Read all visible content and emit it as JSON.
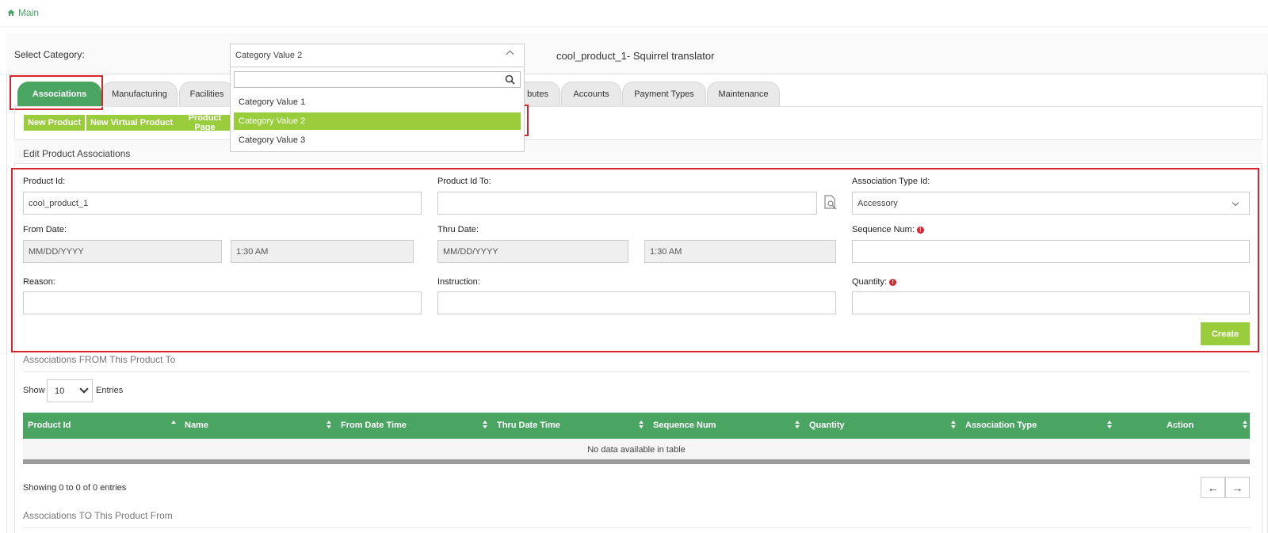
{
  "breadcrumb": {
    "home_label": "Main"
  },
  "header": {
    "select_category_label": "Select Category:",
    "category_value": "Category Value 2",
    "product_title": "cool_product_1- Squirrel translator"
  },
  "category_dropdown": {
    "search_value": "",
    "options": [
      "Category Value 1",
      "Category Value 2",
      "Category Value 3"
    ],
    "selected_index": 1
  },
  "tabs": [
    {
      "label": "Associations",
      "active": true
    },
    {
      "label": "Manufacturing"
    },
    {
      "label": "Facilities"
    },
    {
      "label": "butes"
    },
    {
      "label": "Accounts"
    },
    {
      "label": "Payment Types"
    },
    {
      "label": "Maintenance"
    }
  ],
  "toolbar": {
    "new_product": "New Product",
    "new_virtual_product": "New Virtual Product",
    "product_page": "Product Page"
  },
  "edit_section": {
    "title": "Edit Product Associations",
    "fields": {
      "product_id": {
        "label": "Product Id:",
        "value": "cool_product_1"
      },
      "product_id_to": {
        "label": "Product Id To:",
        "value": ""
      },
      "association_type_id": {
        "label": "Association Type Id:",
        "value": "Accessory"
      },
      "from_date": {
        "label": "From Date:",
        "date_placeholder": "MM/DD/YYYY",
        "time_value": "1:30 AM"
      },
      "thru_date": {
        "label": "Thru Date:",
        "date_placeholder": "MM/DD/YYYY",
        "time_value": "1:30 AM"
      },
      "sequence_num": {
        "label": "Sequence Num:",
        "value": ""
      },
      "reason": {
        "label": "Reason:",
        "value": ""
      },
      "instruction": {
        "label": "Instruction:",
        "value": ""
      },
      "quantity": {
        "label": "Quantity:",
        "value": ""
      }
    },
    "create_label": "Create"
  },
  "from_table": {
    "title": "Associations FROM This Product To",
    "show_label": "Show",
    "entries_value": "10",
    "entries_label": "Entries",
    "columns": [
      "Product Id",
      "Name",
      "From Date Time",
      "Thru Date Time",
      "Sequence Num",
      "Quantity",
      "Association Type",
      "Action"
    ],
    "empty_message": "No data available in table",
    "showing": "Showing 0 to 0 of 0 entries",
    "prev": "←",
    "next": "→"
  },
  "to_table": {
    "title": "Associations TO This Product From"
  },
  "colors": {
    "green": "#4aa562",
    "lime": "#9acd3c",
    "highlight_red": "#d9232d"
  }
}
